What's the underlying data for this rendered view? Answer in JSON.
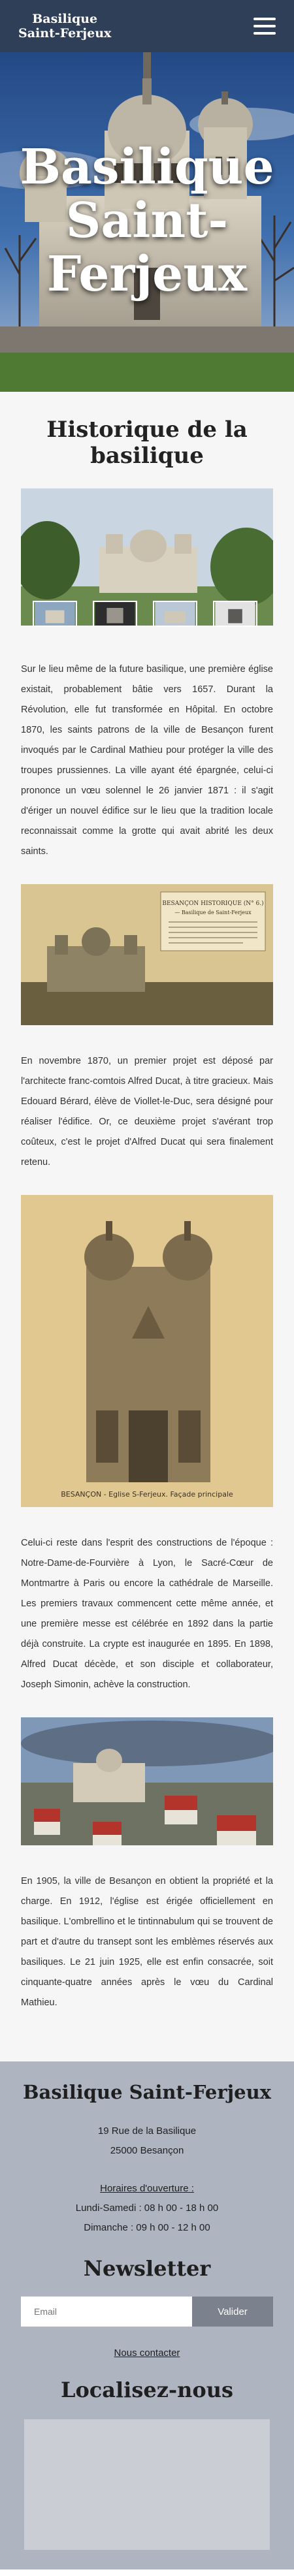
{
  "header": {
    "logo_line1": "Basilique",
    "logo_line2": "Saint-Ferjeux"
  },
  "hero": {
    "title": "Basilique Saint-Ferjeux"
  },
  "history": {
    "title": "Historique de la basilique",
    "p1": "Sur le lieu même de la future basilique, une première église existait, probablement bâtie vers 1657. Durant la Révolution, elle fut transformée en Hôpital. En octobre 1870, les saints patrons de la ville de Besançon furent invoqués par le Cardinal Mathieu pour protéger la ville des troupes prussiennes. La ville ayant été épargnée, celui-ci prononce un vœu solennel le 26 janvier 1871 : il s'agit d'ériger un nouvel édifice sur le lieu que la tradition locale reconnaissait comme la grotte qui avait abrité les deux saints.",
    "p2": "En novembre 1870, un premier projet est déposé par l'architecte franc-comtois Alfred Ducat, à titre gracieux. Mais Edouard Bérard, élève de Viollet-le-Duc, sera désigné pour réaliser l'édifice. Or, ce deuxième projet s'avérant trop coûteux, c'est le projet d'Alfred Ducat qui sera finalement retenu.",
    "p3": "Celui-ci reste dans l'esprit des constructions de l'époque : Notre-Dame-de-Fourvière à Lyon, le Sacré-Cœur de Montmartre à Paris ou encore la cathédrale de Marseille. Les premiers travaux commencent cette même année, et une première messe est célébrée en 1892 dans la partie déjà construite. La crypte est inaugurée en 1895. En 1898, Alfred Ducat décède, et son disciple et collaborateur, Joseph Simonin, achève la construction.",
    "p4": "En 1905, la ville de Besançon en obtient la propriété et la charge. En 1912, l'église est érigée officiellement en basilique. L'ombrellino et le tintinnabulum qui se trouvent de part et d'autre du transept sont les emblèmes réservés aux basiliques. Le 21 juin 1925, elle est enfin consacrée, soit cinquante-quatre années après le vœu du Cardinal Mathieu.",
    "card_header": "BESANÇON HISTORIQUE (N° 6.)",
    "card_sub": "— Basilique de Saint-Ferjeux",
    "postcard_caption": "BESANÇON - Eglise S-Ferjeux. Façade principale"
  },
  "footer": {
    "title": "Basilique Saint-Ferjeux",
    "address1": "19 Rue de la Basilique",
    "address2": "25000 Besançon",
    "hours_title": "Horaires d'ouverture :",
    "hours1": "Lundi-Samedi : 08 h 00 - 18 h 00",
    "hours2": "Dimanche : 09 h 00 - 12 h 00",
    "newsletter_title": "Newsletter",
    "email_placeholder": "Email",
    "submit_label": "Valider",
    "contact_label": "Nous contacter",
    "map_title": "Localisez-nous"
  },
  "colors": {
    "header_bg": "#2f3f57",
    "footer_bg": "#aeb4c0",
    "button_bg": "#7b818d"
  }
}
